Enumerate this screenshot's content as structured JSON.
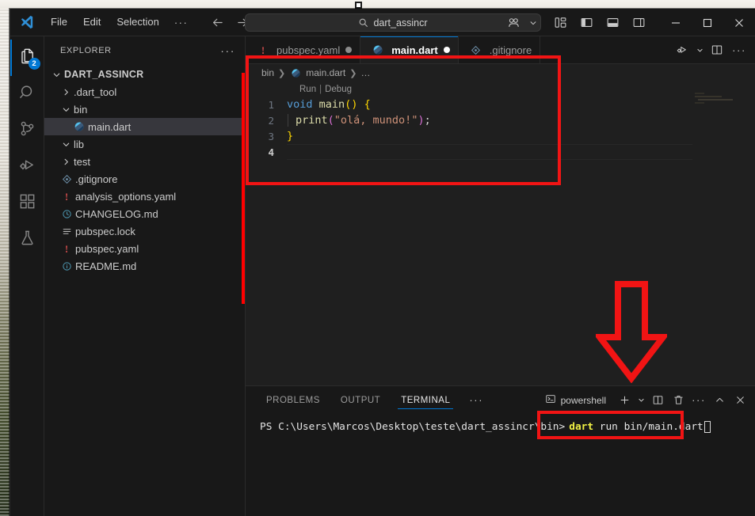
{
  "window": {
    "title": "main.dart",
    "quick_open_value": "dart_assincr",
    "quick_open_icon": "search-icon"
  },
  "menu": {
    "items": [
      "File",
      "Edit",
      "Selection"
    ],
    "more": "···",
    "back_icon": "arrow-left-icon",
    "forward_icon": "arrow-right-icon"
  },
  "titlebar_right": {
    "accounts_icon": "remote-window-icon",
    "chevron_icon": "chevron-down-icon",
    "layout_icons": [
      "customize-layout-icon",
      "toggle-primary-sidebar-icon",
      "toggle-panel-icon",
      "toggle-secondary-sidebar-icon"
    ],
    "minimize_icon": "minimize-icon",
    "maximize_icon": "maximize-icon",
    "close_icon": "close-icon"
  },
  "activitybar": {
    "items": [
      {
        "name": "explorer",
        "icon": "files-icon",
        "active": true,
        "badge": "2"
      },
      {
        "name": "search",
        "icon": "search-icon",
        "active": false,
        "badge": ""
      },
      {
        "name": "source-control",
        "icon": "source-control-icon",
        "active": false,
        "badge": ""
      },
      {
        "name": "run-and-debug",
        "icon": "debug-alt-icon",
        "active": false,
        "badge": ""
      },
      {
        "name": "extensions",
        "icon": "extensions-icon",
        "active": false,
        "badge": ""
      },
      {
        "name": "testing",
        "icon": "beaker-icon",
        "active": false,
        "badge": ""
      }
    ]
  },
  "sidebar": {
    "title": "EXPLORER",
    "actions_icon": "ellipsis-icon",
    "root": {
      "label": "DART_ASSINCR",
      "expanded": true
    },
    "tree": [
      {
        "label": ".dart_tool",
        "type": "folder",
        "expanded": false,
        "indent": 1,
        "icon": "chevron-right-icon",
        "selected": false
      },
      {
        "label": "bin",
        "type": "folder",
        "expanded": true,
        "indent": 1,
        "icon": "chevron-down-icon",
        "selected": false
      },
      {
        "label": "main.dart",
        "type": "file",
        "indent": 2,
        "icon": "dart-icon",
        "selected": true
      },
      {
        "label": "lib",
        "type": "folder",
        "expanded": true,
        "indent": 1,
        "icon": "chevron-down-icon",
        "selected": false
      },
      {
        "label": "test",
        "type": "folder",
        "expanded": false,
        "indent": 1,
        "icon": "chevron-right-icon",
        "selected": false
      },
      {
        "label": ".gitignore",
        "type": "file",
        "indent": 1,
        "icon": "git-icon",
        "selected": false
      },
      {
        "label": "analysis_options.yaml",
        "type": "file",
        "indent": 1,
        "icon": "yaml-icon",
        "selected": false
      },
      {
        "label": "CHANGELOG.md",
        "type": "file",
        "indent": 1,
        "icon": "clock-icon",
        "selected": false
      },
      {
        "label": "pubspec.lock",
        "type": "file",
        "indent": 1,
        "icon": "lock-list-icon",
        "selected": false
      },
      {
        "label": "pubspec.yaml",
        "type": "file",
        "indent": 1,
        "icon": "yaml-icon",
        "selected": false
      },
      {
        "label": "README.md",
        "type": "file",
        "indent": 1,
        "icon": "info-icon",
        "selected": false
      }
    ]
  },
  "tabs": [
    {
      "label": "pubspec.yaml",
      "icon": "yaml-icon",
      "active": false,
      "dirty": true
    },
    {
      "label": "main.dart",
      "icon": "dart-icon",
      "active": true,
      "dirty": true
    },
    {
      "label": ".gitignore",
      "icon": "git-icon",
      "active": false,
      "dirty": false
    }
  ],
  "editor_actions": {
    "run_icon": "run-debug-icon",
    "run_chevron_icon": "chevron-down-icon",
    "split_icon": "split-editor-icon",
    "more_icon": "ellipsis-icon"
  },
  "breadcrumbs": [
    "bin",
    "main.dart",
    "…"
  ],
  "breadcrumb_file_icon": "dart-icon",
  "editor": {
    "codelens": {
      "run": "Run",
      "separator": "|",
      "debug": "Debug"
    },
    "lines": [
      {
        "num": "1",
        "current": false,
        "tokens": [
          {
            "t": "void",
            "c": "tok-key"
          },
          {
            "t": " ",
            "c": "tok-plain"
          },
          {
            "t": "main",
            "c": "tok-fn"
          },
          {
            "t": "(",
            "c": "tok-brkt-y"
          },
          {
            "t": ")",
            "c": "tok-brkt-y"
          },
          {
            "t": " ",
            "c": "tok-plain"
          },
          {
            "t": "{",
            "c": "tok-brkt-y"
          }
        ]
      },
      {
        "num": "2",
        "current": false,
        "indentguide": true,
        "tokens": [
          {
            "t": "print",
            "c": "tok-fn"
          },
          {
            "t": "(",
            "c": "tok-brkt-p"
          },
          {
            "t": "\"olá, mundo!\"",
            "c": "tok-str"
          },
          {
            "t": ")",
            "c": "tok-brkt-p"
          },
          {
            "t": ";",
            "c": "tok-plain"
          }
        ]
      },
      {
        "num": "3",
        "current": false,
        "tokens": [
          {
            "t": "}",
            "c": "tok-brkt-y"
          }
        ]
      },
      {
        "num": "4",
        "current": true,
        "tokens": []
      }
    ]
  },
  "panel": {
    "tabs": [
      {
        "label": "PROBLEMS",
        "active": false
      },
      {
        "label": "OUTPUT",
        "active": false
      },
      {
        "label": "TERMINAL",
        "active": true
      }
    ],
    "more_icon": "ellipsis-icon",
    "terminal_name": "powershell",
    "terminal_icon": "terminal-powershell-icon",
    "actions": {
      "new_terminal_icon": "plus-icon",
      "new_terminal_chevron_icon": "chevron-down-icon",
      "split_terminal_icon": "split-terminal-icon",
      "kill_terminal_icon": "trash-icon",
      "more_icon": "ellipsis-icon",
      "maximize_icon": "chevron-up-icon",
      "close_icon": "close-icon"
    },
    "terminal": {
      "prompt": "PS C:\\Users\\Marcos\\Desktop\\teste\\dart_assincr\\bin>",
      "command_keyword": "dart",
      "command_rest": " run bin/main.dart"
    }
  },
  "annotations": {
    "accent_color": "#f11414",
    "code_box": "highlight-code-editor",
    "command_box": "highlight-terminal-command",
    "arrow": "down-arrow-pointing-to-terminal-command"
  }
}
